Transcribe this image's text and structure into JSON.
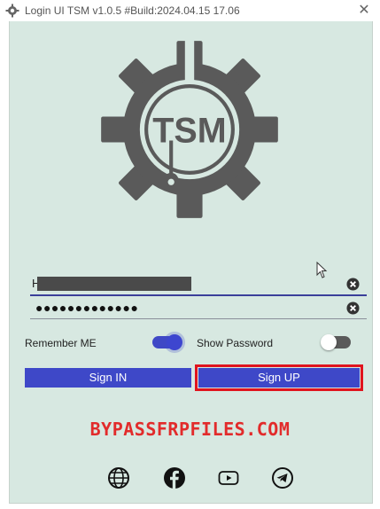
{
  "window": {
    "title": "Login UI TSM v1.0.5 #Build:2024.04.15 17.06",
    "close_symbol": "✕"
  },
  "logo": {
    "text": "TSM",
    "icon": "gear-wrench-logo",
    "colors": {
      "gear": "#5a5a5a",
      "background": "#d7e8e1"
    }
  },
  "form": {
    "username": {
      "value": "H",
      "clear_icon": "clear-circle-icon"
    },
    "password": {
      "value": "●●●●●●●●●●●●●",
      "clear_icon": "clear-circle-icon"
    },
    "remember_label": "Remember ME",
    "remember_on": true,
    "show_password_label": "Show Password",
    "show_password_on": false
  },
  "buttons": {
    "sign_in": "Sign IN",
    "sign_up": "Sign UP"
  },
  "watermark": "BYPASSFRPFILES.COM",
  "social": [
    "globe-icon",
    "facebook-icon",
    "youtube-icon",
    "telegram-icon"
  ],
  "colors": {
    "accent": "#3e48c8",
    "highlight": "#e0141e",
    "watermark": "#e22b2b"
  }
}
